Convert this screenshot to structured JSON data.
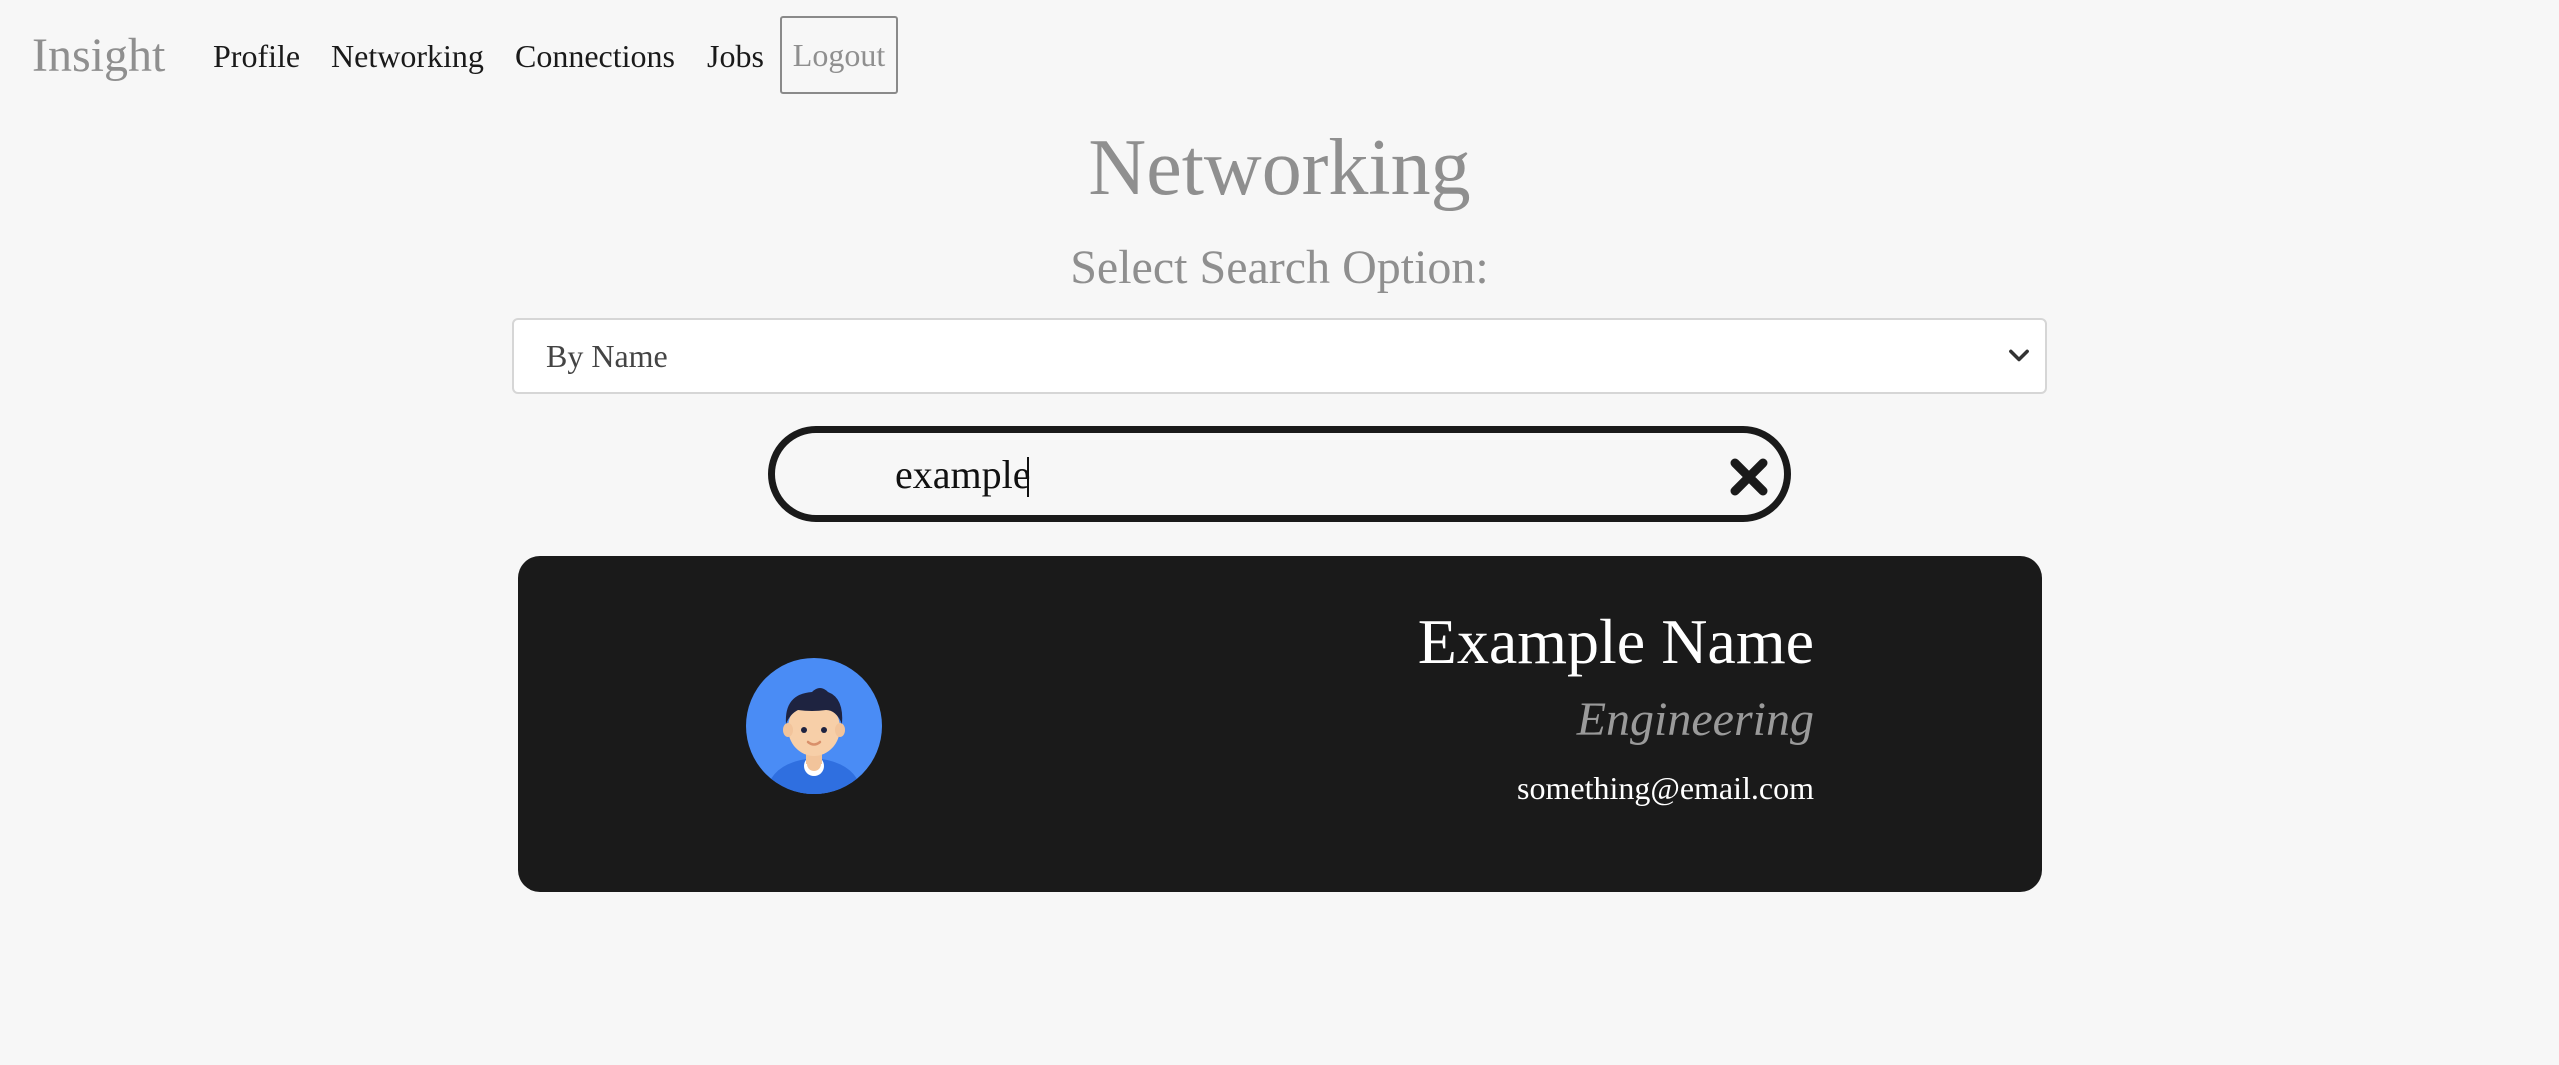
{
  "nav": {
    "brand": "Insight",
    "links": [
      "Profile",
      "Networking",
      "Connections",
      "Jobs"
    ],
    "logout": "Logout"
  },
  "page": {
    "title": "Networking",
    "subtitle": "Select Search Option:"
  },
  "search_option": {
    "selected": "By Name"
  },
  "search": {
    "value": "example"
  },
  "results": [
    {
      "name": "Example Name",
      "department": "Engineering",
      "email": "something@email.com"
    }
  ],
  "colors": {
    "background": "#f7f7f7",
    "card": "#1a1a1a",
    "muted_text": "#8f8f8f",
    "avatar_bg": "#4a8cf5"
  },
  "icons": {
    "select": "chevron-down-icon",
    "clear": "close-icon",
    "avatar": "user-avatar-icon"
  }
}
